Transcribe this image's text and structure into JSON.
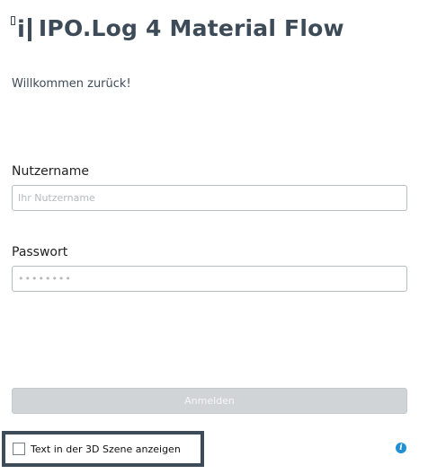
{
  "app": {
    "title": "IPO.Log 4 Material Flow",
    "logo_icon": "ipo-log-logo"
  },
  "welcome_text": "Willkommen zurück!",
  "username": {
    "label": "Nutzername",
    "placeholder": "Ihr Nutzername",
    "value": ""
  },
  "password": {
    "label": "Passwort",
    "placeholder": "••••••••",
    "value": ""
  },
  "login_button": {
    "label": "Anmelden",
    "enabled": false
  },
  "show_text_3d": {
    "label": "Text in der 3D Szene anzeigen",
    "checked": false
  },
  "info": {
    "icon": "info-icon",
    "color": "#1e90d6"
  },
  "colors": {
    "brand": "#3d4a57",
    "button_disabled": "#d1d4d7"
  }
}
